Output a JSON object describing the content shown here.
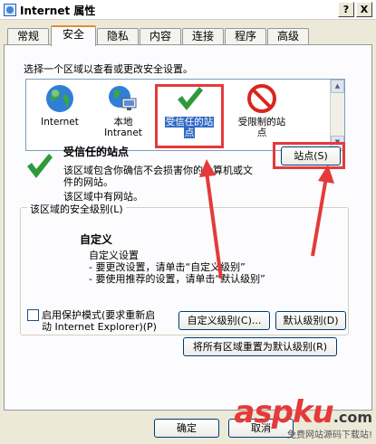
{
  "window": {
    "title": "Internet 属性",
    "help_label": "?",
    "close_label": "X"
  },
  "tabs": [
    {
      "label": "常规"
    },
    {
      "label": "安全"
    },
    {
      "label": "隐私"
    },
    {
      "label": "内容"
    },
    {
      "label": "连接"
    },
    {
      "label": "程序"
    },
    {
      "label": "高级"
    }
  ],
  "security": {
    "instruction": "选择一个区域以查看或更改安全设置。",
    "zones": [
      {
        "label": "Internet",
        "icon": "globe-icon"
      },
      {
        "label": "本地",
        "label2": "Intranet",
        "icon": "intranet-icon"
      },
      {
        "label": "受信任的站",
        "label2": "点",
        "icon": "checkmark-icon",
        "selected": true
      },
      {
        "label": "受限制的站",
        "label2": "点",
        "icon": "restricted-icon"
      }
    ],
    "zone_title": "受信任的站点",
    "zone_desc_line1": "该区域包含你确信不会损害你的计算机或文",
    "zone_desc_line2": "件的网站。",
    "zone_has_sites": "该区域中有网站。",
    "sites_button": "站点(S)",
    "level_group_label": "该区域的安全级别(L)",
    "level_title": "自定义",
    "level_line1": "自定义设置",
    "level_line2": "- 要更改设置，请单击“自定义级别”",
    "level_line3": "- 要使用推荐的设置，请单击“默认级别”",
    "protected_mode_line1": "启用保护模式(要求重新启",
    "protected_mode_line2": "动 Internet Explorer)(P)",
    "custom_level_button": "自定义级别(C)...",
    "default_level_button": "默认级别(D)",
    "reset_all_button": "将所有区域重置为默认级别(R)"
  },
  "footer": {
    "ok_button": "确定",
    "cancel_button": "取消"
  },
  "watermark": {
    "logo": "aspku",
    "tld": ".com",
    "caption": "免费网站源码下载站!"
  },
  "colors": {
    "accent": "#316ac5",
    "annotation_red": "#e53a3a",
    "tab_highlight": "#e68b2c"
  }
}
